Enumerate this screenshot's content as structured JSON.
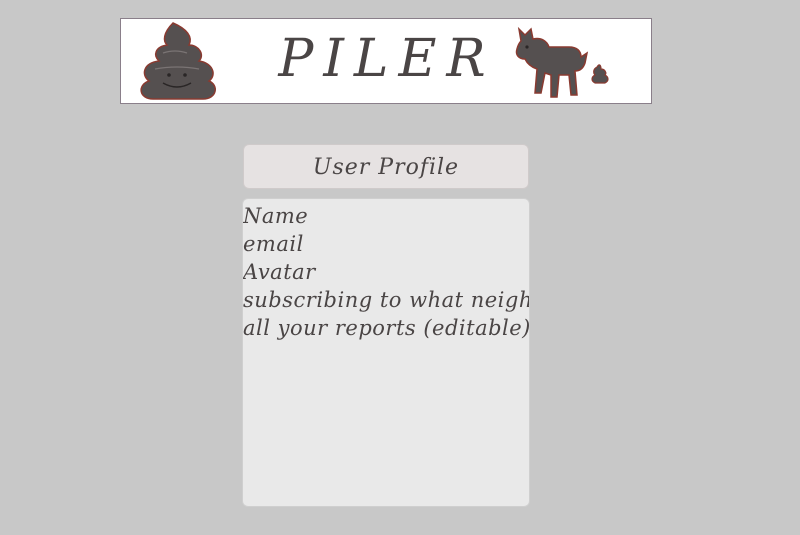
{
  "banner": {
    "title": "PILER",
    "left_icon": "poop-icon",
    "right_icon": "dog-pooping-icon"
  },
  "panel": {
    "heading": "User Profile",
    "items": [
      "Name",
      "email",
      "Avatar",
      "subscribing to what neighb",
      "all your reports (editable)"
    ]
  },
  "colors": {
    "background": "#c8c8c8",
    "banner_bg": "#ffffff",
    "text": "#4a4545",
    "header_bg": "#e6e2e2",
    "panel_bg": "#e9e9e9",
    "icon_fill": "#555050",
    "icon_outline": "#8a3a30"
  }
}
